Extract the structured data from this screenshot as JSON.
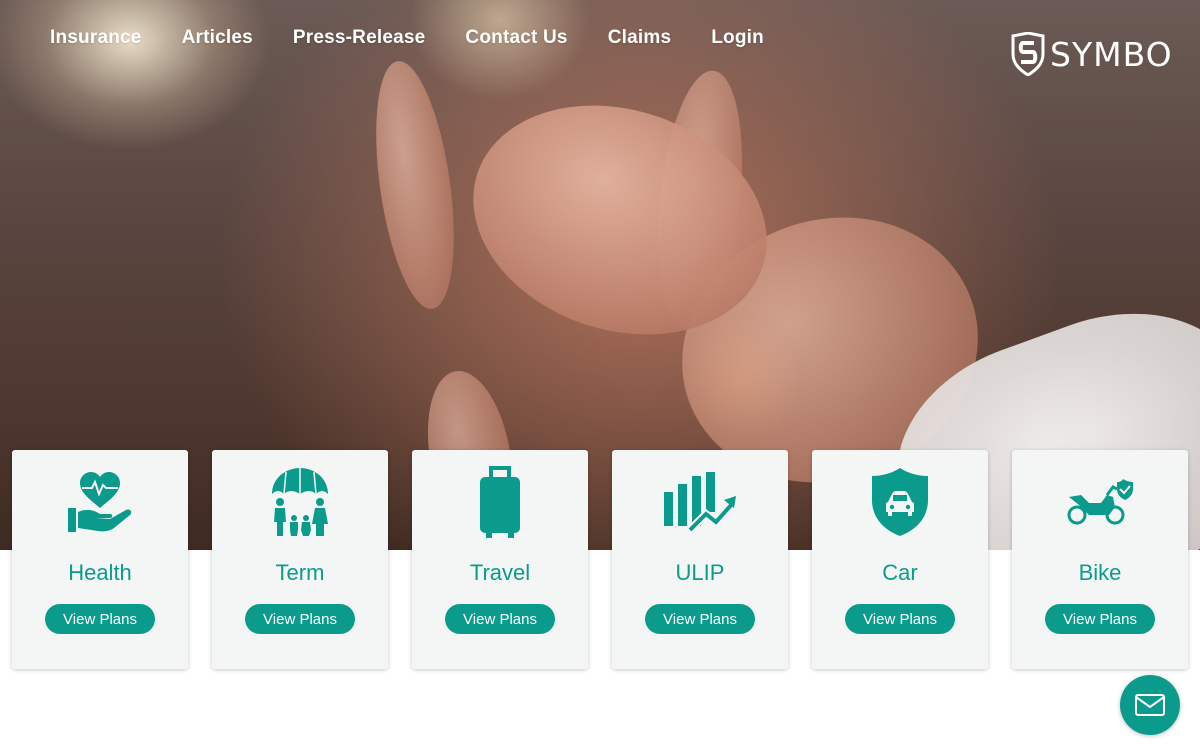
{
  "nav": {
    "items": [
      {
        "label": "Insurance"
      },
      {
        "label": "Articles"
      },
      {
        "label": "Press-Release"
      },
      {
        "label": "Contact Us"
      },
      {
        "label": "Claims"
      },
      {
        "label": "Login"
      }
    ]
  },
  "logo": {
    "text": "SYMBO"
  },
  "products": [
    {
      "title": "Health",
      "button": "View Plans",
      "icon": "heart-in-hand-icon"
    },
    {
      "title": "Term",
      "button": "View Plans",
      "icon": "family-umbrella-icon"
    },
    {
      "title": "Travel",
      "button": "View Plans",
      "icon": "suitcase-icon"
    },
    {
      "title": "ULIP",
      "button": "View Plans",
      "icon": "growth-chart-icon"
    },
    {
      "title": "Car",
      "button": "View Plans",
      "icon": "car-shield-icon"
    },
    {
      "title": "Bike",
      "button": "View Plans",
      "icon": "bike-check-icon"
    }
  ],
  "colors": {
    "accent": "#0a9b8c",
    "card_bg": "#f4f6f5"
  },
  "chat": {
    "icon": "mail-icon"
  }
}
